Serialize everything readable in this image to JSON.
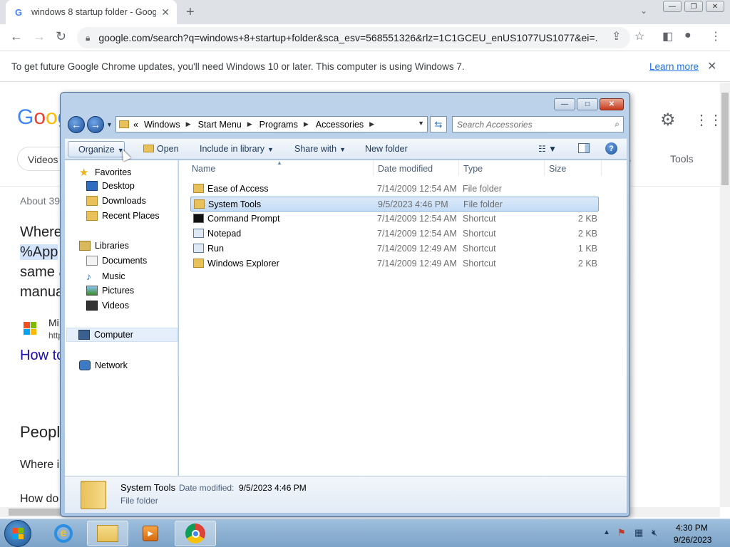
{
  "chrome": {
    "tab_title": "windows 8 startup folder - Goog",
    "url": "google.com/search?q=windows+8+startup+folder&sca_esv=568551326&rlz=1C1GCEU_enUS1077US1077&ei=...",
    "update_message": "To get future Google Chrome updates, you'll need Windows 10 or later. This computer is using Windows 7.",
    "learn_more": "Learn more"
  },
  "google_page": {
    "logo": [
      "G",
      "o",
      "o",
      "g"
    ],
    "videos_chip": "Videos",
    "tools": "Tools",
    "s_fragment": "s",
    "about": "About 39",
    "snippet_line1": "Where",
    "snippet_line2": "%App",
    "snippet_line3": "same a",
    "snippet_line4": "manua",
    "source_line1": "Mi",
    "source_line2": "http",
    "link_fragment": "How to",
    "people_fragment": "Peopl",
    "q1_fragment": "Where i",
    "q2_fragment": "How do"
  },
  "explorer": {
    "breadcrumbs": [
      "Windows",
      "Start Menu",
      "Programs",
      "Accessories"
    ],
    "breadcrumb_lead": "«",
    "search_placeholder": "Search Accessories",
    "commands": {
      "organize": "Organize",
      "open": "Open",
      "include_in_library": "Include in library",
      "share_with": "Share with",
      "new_folder": "New folder"
    },
    "nav": {
      "favorites": "Favorites",
      "desktop": "Desktop",
      "downloads": "Downloads",
      "recent_places": "Recent Places",
      "libraries": "Libraries",
      "documents": "Documents",
      "music": "Music",
      "pictures": "Pictures",
      "videos": "Videos",
      "computer": "Computer",
      "network": "Network"
    },
    "columns": {
      "name": "Name",
      "date": "Date modified",
      "type": "Type",
      "size": "Size"
    },
    "files": [
      {
        "name": "Ease of Access",
        "date": "7/14/2009 12:54 AM",
        "type": "File folder",
        "size": "",
        "icon": "folder-icon"
      },
      {
        "name": "System Tools",
        "date": "9/5/2023 4:46 PM",
        "type": "File folder",
        "size": "",
        "icon": "folder-icon"
      },
      {
        "name": "Command Prompt",
        "date": "7/14/2009 12:54 AM",
        "type": "Shortcut",
        "size": "2 KB",
        "icon": "command-prompt-icon"
      },
      {
        "name": "Notepad",
        "date": "7/14/2009 12:54 AM",
        "type": "Shortcut",
        "size": "2 KB",
        "icon": "notepad-icon"
      },
      {
        "name": "Run",
        "date": "7/14/2009 12:49 AM",
        "type": "Shortcut",
        "size": "1 KB",
        "icon": "run-icon"
      },
      {
        "name": "Windows Explorer",
        "date": "7/14/2009 12:49 AM",
        "type": "Shortcut",
        "size": "2 KB",
        "icon": "windows-explorer-icon"
      }
    ],
    "details": {
      "name": "System Tools",
      "date_label": "Date modified:",
      "date_value": "9/5/2023 4:46 PM",
      "type": "File folder"
    }
  },
  "taskbar": {
    "time": "4:30 PM",
    "date": "9/26/2023"
  }
}
